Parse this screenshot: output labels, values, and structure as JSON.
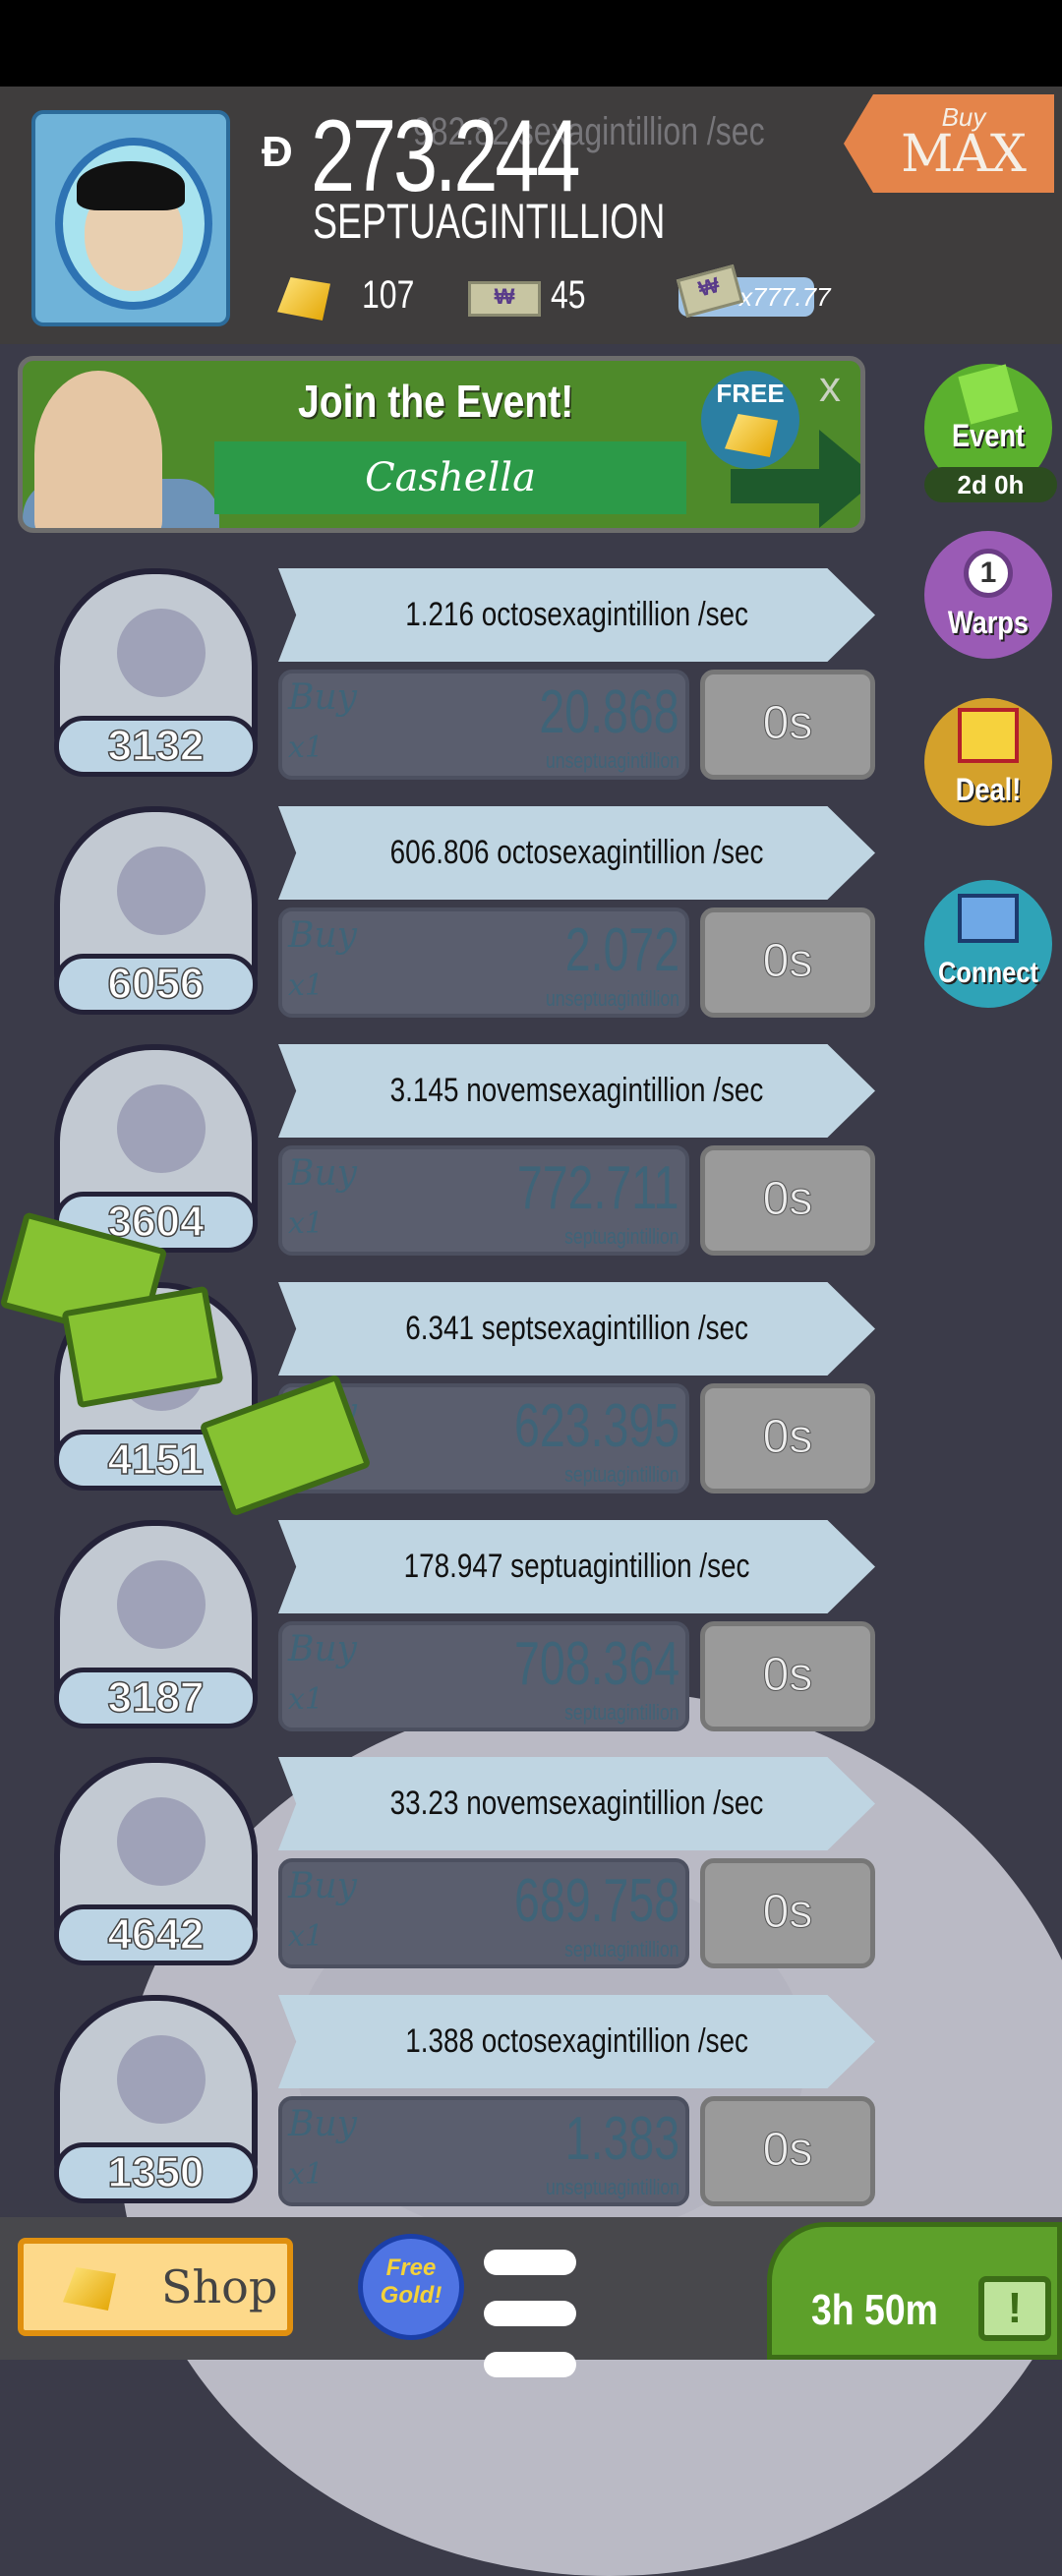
{
  "header": {
    "money_symbol": "Ð",
    "money_value": "273.244",
    "money_unit": "SEPTUAGINTILLION",
    "ghost_rate": "982.82 sexagintillion /sec",
    "gold_count": "107",
    "megabucks_count": "45",
    "multiplier": "x777.77",
    "buy_max": {
      "buy": "Buy",
      "max": "MAX"
    }
  },
  "event_banner": {
    "title": "Join the Event!",
    "name": "Cashella",
    "free_label": "FREE",
    "close": "x"
  },
  "side_badges": {
    "event": {
      "label": "Event",
      "time": "2d 0h"
    },
    "warps": {
      "label": "Warps",
      "count": "1"
    },
    "deal": {
      "label": "Deal!"
    },
    "connect": {
      "label": "Connect"
    }
  },
  "businesses": [
    {
      "count": "3132",
      "rate": "1.216 octosexagintillion /sec",
      "buy": "Buy",
      "mult": "x1",
      "cost": "20.868",
      "cost_unit": "unseptuagintillion",
      "time": "0s",
      "icon": "moon-rocket-icon"
    },
    {
      "count": "6056",
      "rate": "606.806 octosexagintillion /sec",
      "buy": "Buy",
      "mult": "x1",
      "cost": "2.072",
      "cost_unit": "unseptuagintillion",
      "time": "0s",
      "icon": "cocktail-icon"
    },
    {
      "count": "3604",
      "rate": "3.145 novemsexagintillion /sec",
      "buy": "Buy",
      "mult": "x1",
      "cost": "772.711",
      "cost_unit": "septuagintillion",
      "time": "0s",
      "icon": "barn-dome-icon"
    },
    {
      "count": "4151",
      "rate": "6.341 septsexagintillion /sec",
      "buy": "Buy",
      "mult": "x1",
      "cost": "623.395",
      "cost_unit": "septuagintillion",
      "time": "0s",
      "icon": "machine-icon"
    },
    {
      "count": "3187",
      "rate": "178.947 septuagintillion /sec",
      "buy": "Buy",
      "mult": "x1",
      "cost": "708.364",
      "cost_unit": "septuagintillion",
      "time": "0s",
      "icon": "amusement-park-icon"
    },
    {
      "count": "4642",
      "rate": "33.23 novemsexagintillion /sec",
      "buy": "Buy",
      "mult": "x1",
      "cost": "689.758",
      "cost_unit": "septuagintillion",
      "time": "0s",
      "icon": "werewolf-icon"
    },
    {
      "count": "1350",
      "rate": "1.388 octosexagintillion /sec",
      "buy": "Buy",
      "mult": "x1",
      "cost": "1.383",
      "cost_unit": "unseptuagintillion",
      "time": "0s",
      "icon": "ray-gun-icon"
    }
  ],
  "bottom": {
    "shop": "Shop",
    "free_gold": "Free Gold!",
    "tv_timer": "3h 50m",
    "tv_icon": "!"
  }
}
